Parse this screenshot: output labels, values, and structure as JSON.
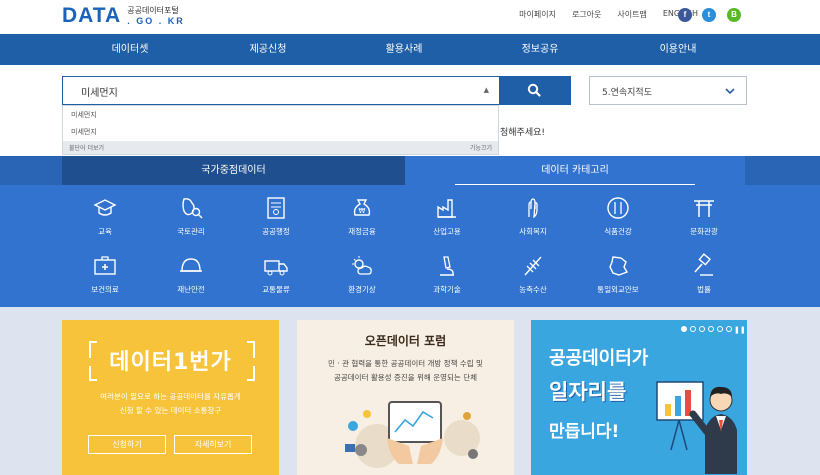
{
  "header": {
    "logo_main": "DATA",
    "logo_kr": "공공데이터포털",
    "logo_sub": ". GO . KR",
    "links": [
      "마이페이지",
      "로그아웃",
      "사이트맵",
      "ENGLISH"
    ],
    "sns": [
      {
        "name": "facebook-icon",
        "glyph": "f",
        "color": "#3b5998"
      },
      {
        "name": "twitter-icon",
        "glyph": "t",
        "color": "#2b8ed8"
      },
      {
        "name": "blog-icon",
        "glyph": "B",
        "color": "#5ab828"
      }
    ]
  },
  "nav": {
    "items": [
      "데이터셋",
      "제공신청",
      "활용사례",
      "정보공유",
      "이용안내"
    ]
  },
  "search": {
    "value": "미세먼지",
    "select_value": "5.연속지적도",
    "suggestions": [
      "미세먼지",
      "미세먼지"
    ],
    "suggest_footer_left": "불단어 더보기",
    "suggest_footer_right": "기능끄기",
    "hint_tail": "청해주세요!"
  },
  "tabs": {
    "national": "국가중점데이터",
    "category": "데이터 카테고리"
  },
  "categories_row1": [
    "교육",
    "국토관리",
    "공공행정",
    "재정금융",
    "산업고용",
    "사회복지",
    "식품건강",
    "문화관광"
  ],
  "categories_row2": [
    "보건의료",
    "재난안전",
    "교통물류",
    "환경기상",
    "과학기술",
    "농축수산",
    "통일외교안보",
    "법률"
  ],
  "banners": {
    "b1": {
      "title": "데이터1번가",
      "desc1": "여러분이 필요로 하는 공공데이터를 자유롭게",
      "desc2": "신청 할 수 있는 데이터 소통창구",
      "btn1": "신청하기",
      "btn2": "자세히보기"
    },
    "b2": {
      "title": "오픈데이터 포럼",
      "desc1": "민 · 관 협력을 통한 공공데이터 개방 정책 수립 및",
      "desc2": "공공데이터 활용성 증진을 위해 운영되는 단체"
    },
    "b3": {
      "line1": "공공데이터가",
      "line2": "일자리를",
      "line3": "만듭니다!"
    }
  },
  "colors": {
    "primary": "#1e5fa8",
    "band": "#3173cf",
    "banner_yellow": "#f6c33b",
    "banner_blue": "#3aa6df"
  }
}
